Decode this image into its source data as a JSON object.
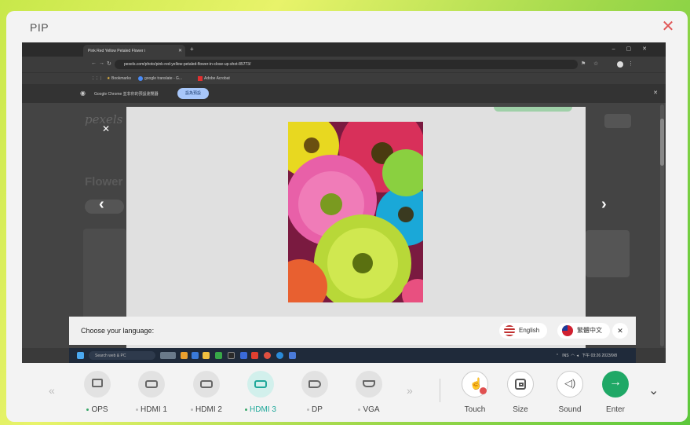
{
  "window": {
    "title": "PIP",
    "close_icon": "close-icon",
    "accent": "#e05555"
  },
  "browser": {
    "tab_title": "Pink Red Yellow Petaled Flower i",
    "url": "pexels.com/photo/pink-red-yellow-petaled-flower-in-close-up-shot-85773/",
    "bookmarks": [
      "Bookmarks",
      "google translate - G...",
      "Adobe Acrobat"
    ],
    "infobar_text": "Google Chrome 並非你的預設瀏覽器",
    "infobar_button": "設為預設"
  },
  "page": {
    "logo": "pexels",
    "heading": "Flower"
  },
  "language_bar": {
    "prompt": "Choose your language:",
    "options": [
      "English",
      "繁體中文"
    ]
  },
  "taskbar": {
    "search": "Search web & PC",
    "status": "INS",
    "time": "下午 03:26",
    "date": "2023/9/8"
  },
  "sources": [
    {
      "label": "OPS",
      "icon": "monitor-icon",
      "active": false,
      "dot": true
    },
    {
      "label": "HDMI 1",
      "icon": "hdmi-icon",
      "active": false,
      "dot": false
    },
    {
      "label": "HDMI 2",
      "icon": "hdmi-icon",
      "active": false,
      "dot": false
    },
    {
      "label": "HDMI 3",
      "icon": "hdmi-icon",
      "active": true,
      "dot": true
    },
    {
      "label": "DP",
      "icon": "dp-icon",
      "active": false,
      "dot": false
    },
    {
      "label": "VGA",
      "icon": "vga-icon",
      "active": false,
      "dot": false
    }
  ],
  "controls": [
    {
      "label": "Touch",
      "icon": "touch-icon"
    },
    {
      "label": "Size",
      "icon": "size-icon"
    },
    {
      "label": "Sound",
      "icon": "sound-icon"
    },
    {
      "label": "Enter",
      "icon": "enter-icon"
    }
  ],
  "colors": {
    "active_source": "#1fa89a",
    "enter": "#1fa866",
    "status_dot": "#3aa86a"
  }
}
